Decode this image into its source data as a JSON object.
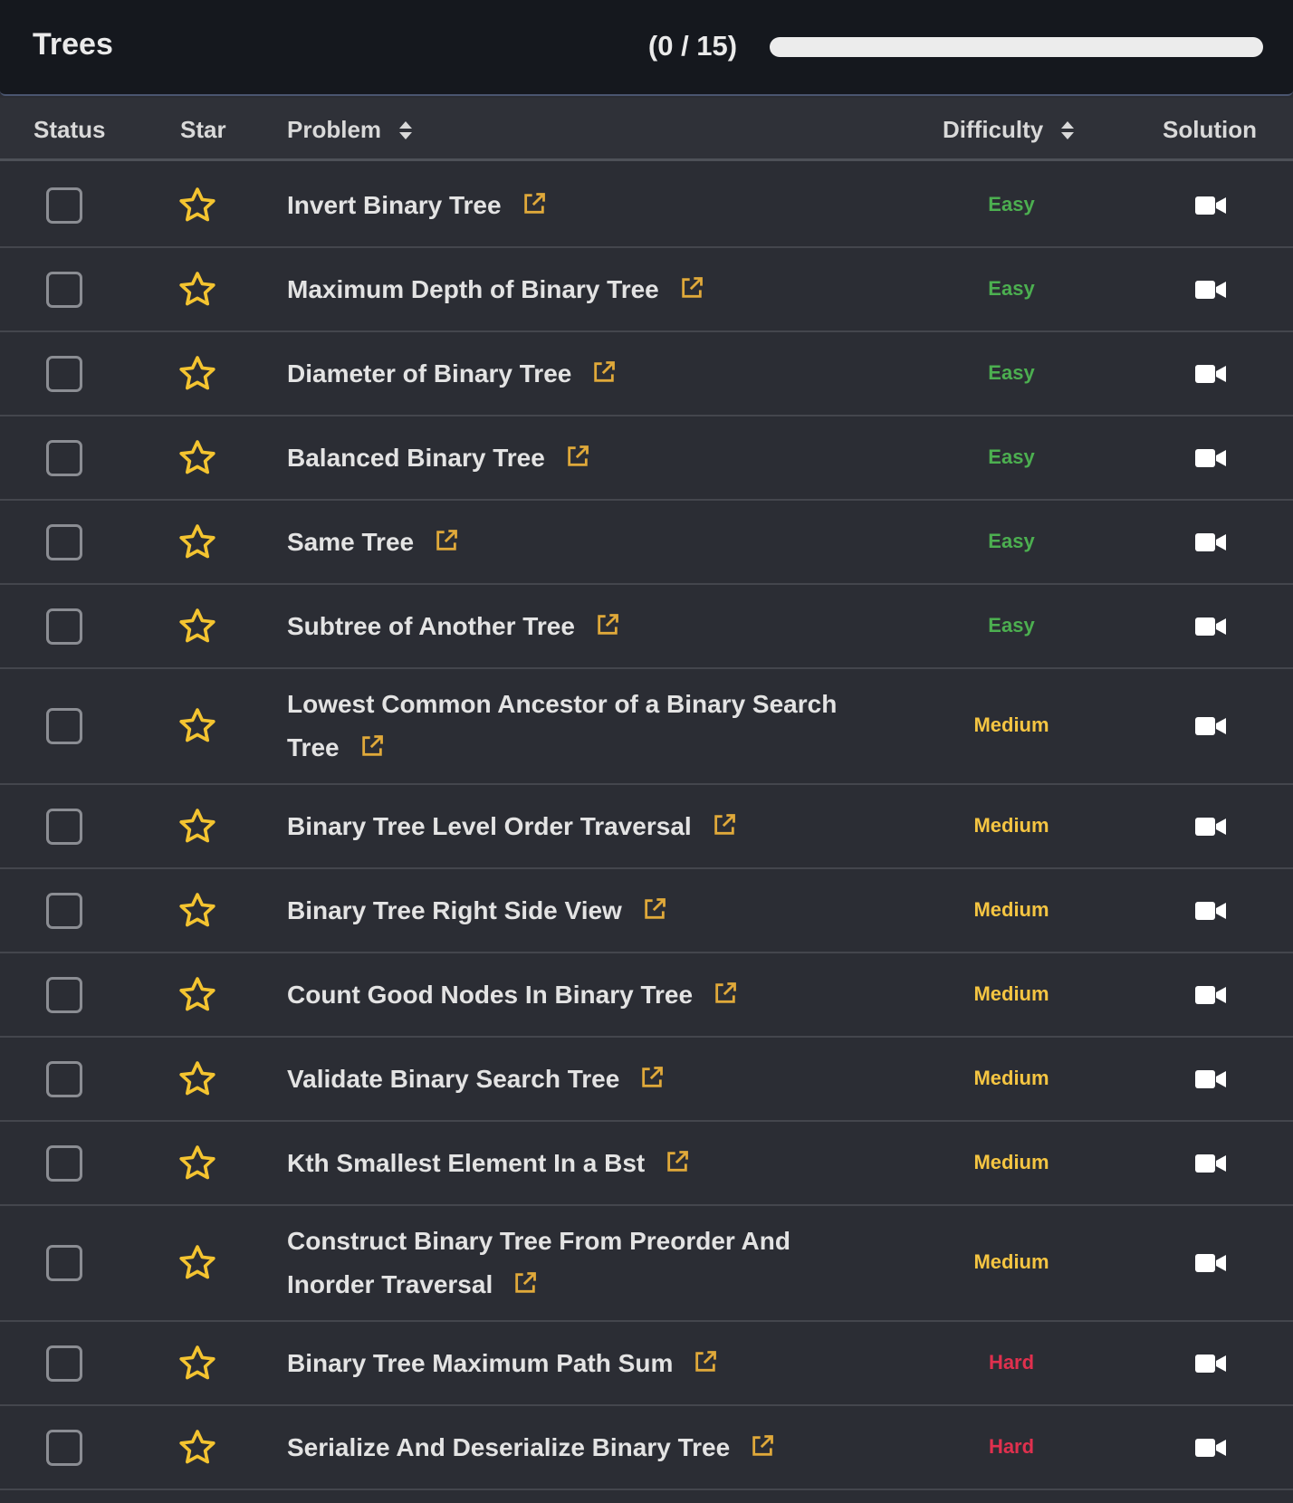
{
  "header": {
    "title": "Trees",
    "progress_text": "(0 / 15)",
    "progress_fraction": 0
  },
  "table": {
    "columns": {
      "status": "Status",
      "star": "Star",
      "problem": "Problem",
      "difficulty": "Difficulty",
      "solution": "Solution"
    },
    "rows": [
      {
        "problem": "Invert Binary Tree",
        "difficulty": "Easy",
        "completed": false,
        "starred": false
      },
      {
        "problem": "Maximum Depth of Binary Tree",
        "difficulty": "Easy",
        "completed": false,
        "starred": false
      },
      {
        "problem": "Diameter of Binary Tree",
        "difficulty": "Easy",
        "completed": false,
        "starred": false
      },
      {
        "problem": "Balanced Binary Tree",
        "difficulty": "Easy",
        "completed": false,
        "starred": false
      },
      {
        "problem": "Same Tree",
        "difficulty": "Easy",
        "completed": false,
        "starred": false
      },
      {
        "problem": "Subtree of Another Tree",
        "difficulty": "Easy",
        "completed": false,
        "starred": false
      },
      {
        "problem": "Lowest Common Ancestor of a Binary Search Tree",
        "difficulty": "Medium",
        "completed": false,
        "starred": false
      },
      {
        "problem": "Binary Tree Level Order Traversal",
        "difficulty": "Medium",
        "completed": false,
        "starred": false
      },
      {
        "problem": "Binary Tree Right Side View",
        "difficulty": "Medium",
        "completed": false,
        "starred": false
      },
      {
        "problem": "Count Good Nodes In Binary Tree",
        "difficulty": "Medium",
        "completed": false,
        "starred": false
      },
      {
        "problem": "Validate Binary Search Tree",
        "difficulty": "Medium",
        "completed": false,
        "starred": false
      },
      {
        "problem": "Kth Smallest Element In a Bst",
        "difficulty": "Medium",
        "completed": false,
        "starred": false
      },
      {
        "problem": "Construct Binary Tree From Preorder And Inorder Traversal",
        "difficulty": "Medium",
        "completed": false,
        "starred": false
      },
      {
        "problem": "Binary Tree Maximum Path Sum",
        "difficulty": "Hard",
        "completed": false,
        "starred": false
      },
      {
        "problem": "Serialize And Deserialize Binary Tree",
        "difficulty": "Hard",
        "completed": false,
        "starred": false
      }
    ]
  },
  "colors": {
    "easy": "#4caf50",
    "medium": "#f5c542",
    "hard": "#e0304e",
    "star": "#f4c430",
    "link": "#e0a93a"
  },
  "icons": {
    "star": "star-icon",
    "external_link": "external-link-icon",
    "solution": "video-camera-icon"
  }
}
